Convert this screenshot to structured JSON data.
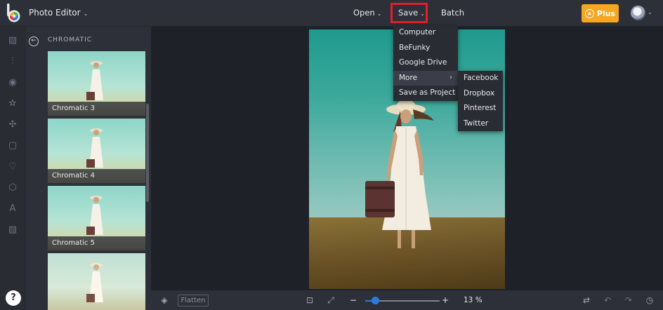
{
  "topbar": {
    "app_title": "Photo Editor",
    "open_label": "Open",
    "save_label": "Save",
    "batch_label": "Batch",
    "plus_label": "Plus"
  },
  "panel": {
    "title": "CHROMATIC",
    "thumbnails": [
      "Chromatic 3",
      "Chromatic 4",
      "Chromatic 5"
    ]
  },
  "save_menu": {
    "items": [
      "Computer",
      "BeFunky",
      "Google Drive",
      "More",
      "Save as Project"
    ],
    "more_submenu": [
      "Facebook",
      "Dropbox",
      "Pinterest",
      "Twitter"
    ]
  },
  "bottombar": {
    "flatten_label": "Flatten",
    "zoom_value": "13 %",
    "zoom_fraction": 0.13
  },
  "help_label": "?"
}
